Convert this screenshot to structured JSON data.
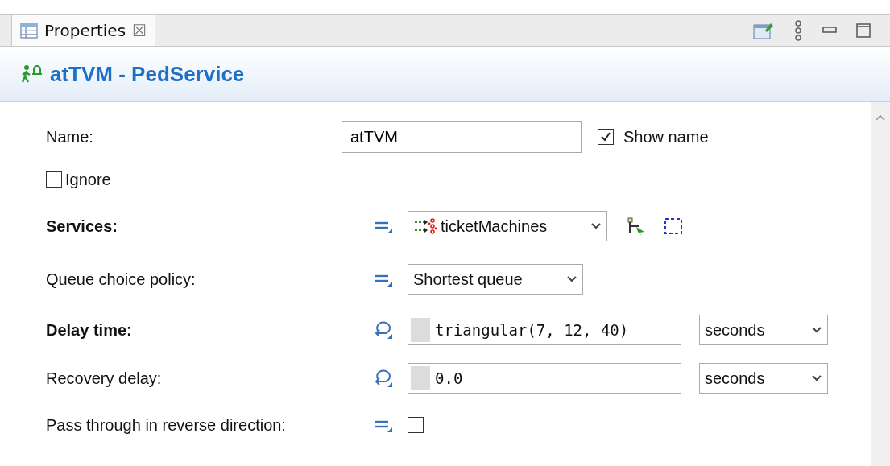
{
  "tab": {
    "label": "Properties",
    "selected": true,
    "close": "☒"
  },
  "header": {
    "title": "atTVM - PedService"
  },
  "properties": [
    {
      "kind": "name",
      "label": "Name:",
      "value": "atTVM",
      "show_name": {
        "label": "Show name",
        "checked": true
      }
    },
    {
      "kind": "checkbox",
      "label": "Ignore",
      "checked": false
    },
    {
      "kind": "choice",
      "label": "Services:",
      "emphasized": true,
      "expression": false,
      "value": "ticketMachines",
      "with_tools": true
    },
    {
      "kind": "choice",
      "label": "Queue choice policy:",
      "emphasized": false,
      "expression": false,
      "value": "Shortest queue",
      "with_tools": false
    },
    {
      "kind": "code",
      "label": "Delay time:",
      "emphasized": true,
      "expression": true,
      "value": "triangular(7, 12, 40)",
      "unit": "seconds"
    },
    {
      "kind": "code",
      "label": "Recovery delay:",
      "emphasized": false,
      "expression": true,
      "value": "0.0",
      "unit": "seconds"
    },
    {
      "kind": "flag",
      "label": "Pass through in reverse direction:",
      "emphasized": false,
      "expression": false,
      "checked": false
    }
  ]
}
